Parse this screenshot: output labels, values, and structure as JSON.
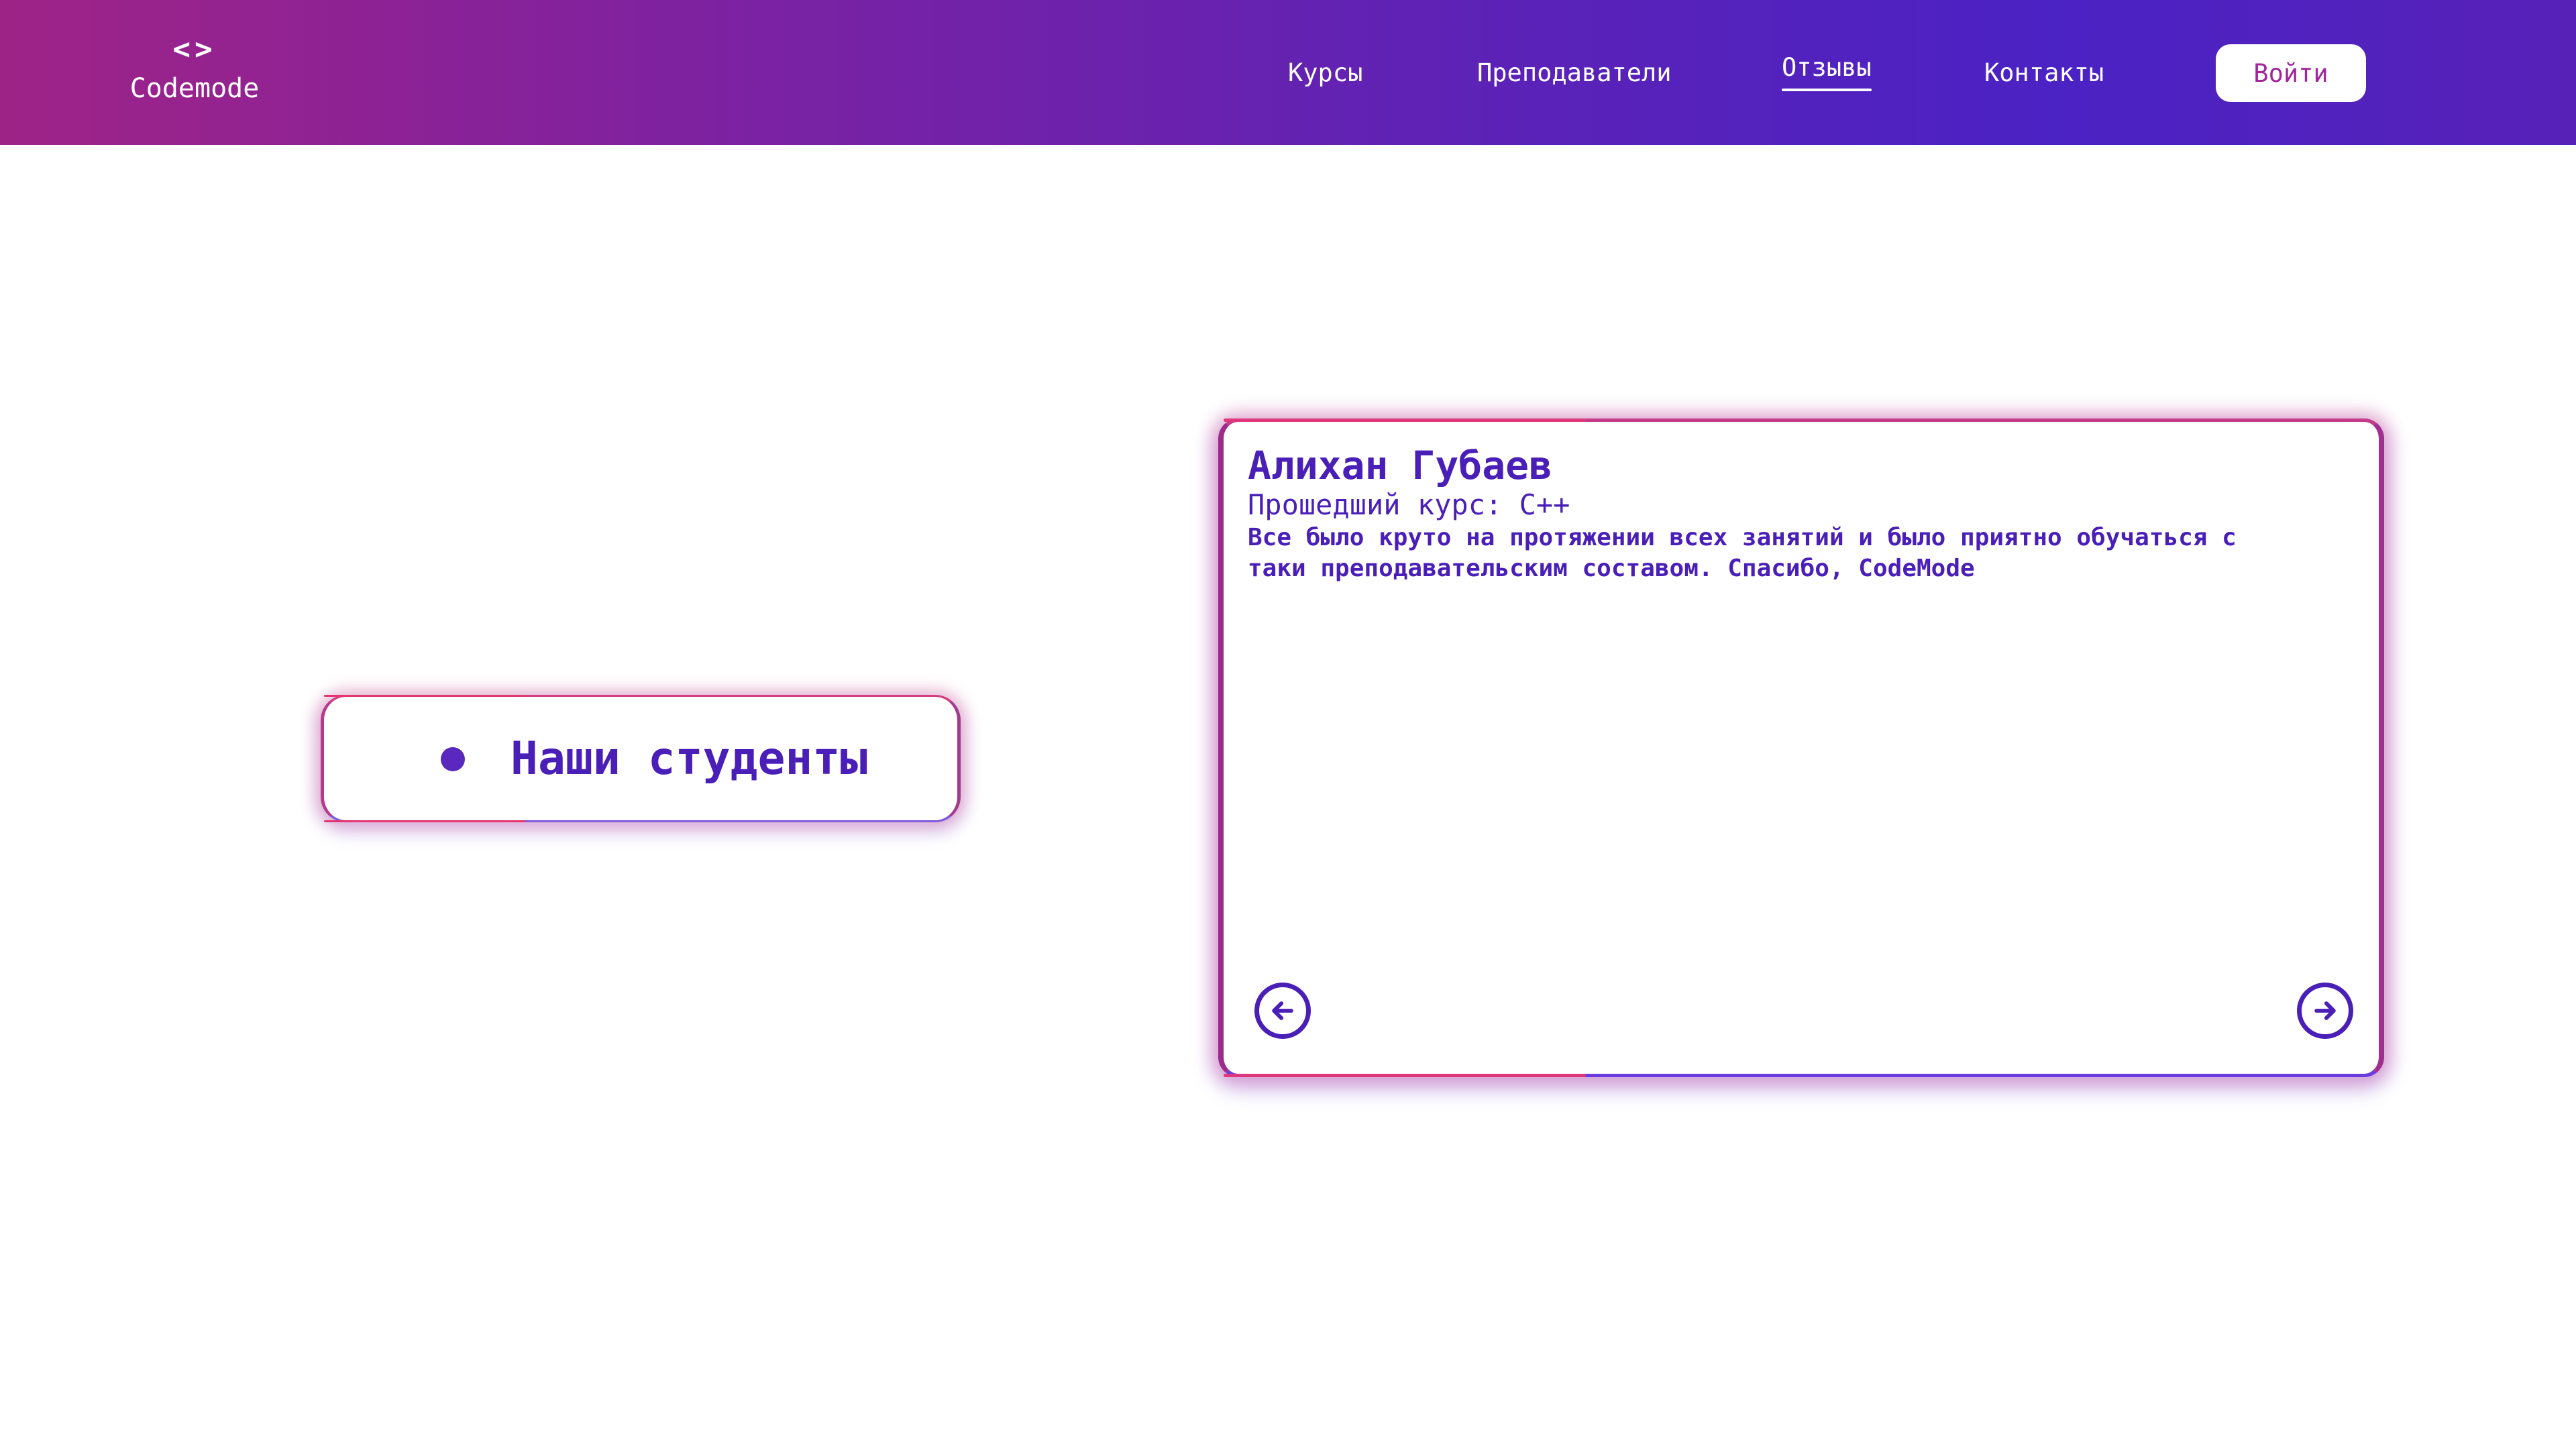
{
  "header": {
    "logo": {
      "icon": "<>",
      "icon_name": "code-brackets-icon",
      "name": "Codemode"
    },
    "nav": [
      {
        "label": "Курсы"
      },
      {
        "label": "Преподаватели"
      },
      {
        "label": "Отзывы",
        "active": true
      },
      {
        "label": "Контакты"
      }
    ],
    "login_label": "Войти",
    "gradient_colors": [
      "#9f2387",
      "#4b22c4"
    ]
  },
  "students_section": {
    "title": "Наши студенты"
  },
  "review": {
    "name": "Алихан Губаев",
    "course": "Прошедший курс: C++",
    "text": "Все было круто на протяжении всех занятий и было приятно обучаться с таки преподавательским составом. Спасибо, CodeMode",
    "prev_icon": "arrow-left-circle-icon",
    "next_icon": "arrow-right-circle-icon"
  },
  "colors": {
    "accent": "#4a1fb8",
    "pink": "#e0367a",
    "login_text": "#a0279c"
  }
}
